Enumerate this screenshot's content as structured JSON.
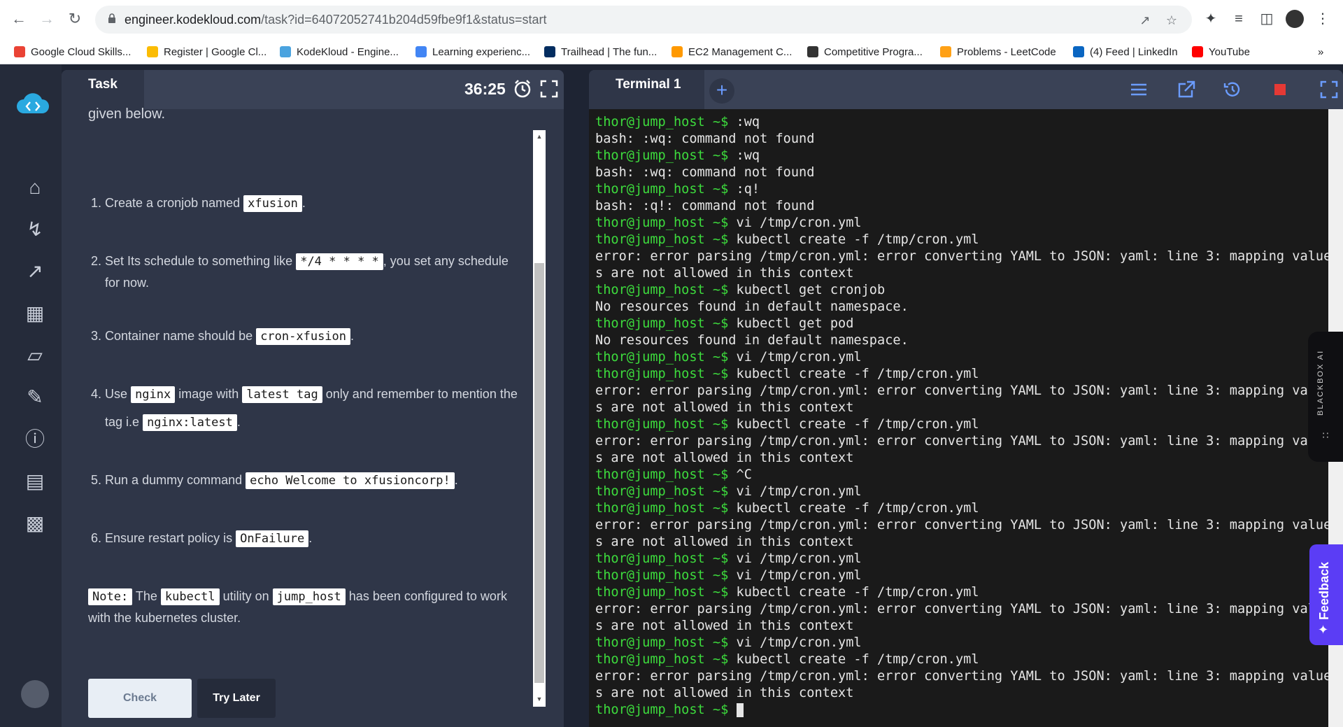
{
  "browser": {
    "url_host": "engineer.kodekloud.com",
    "url_rest": "/task?id=64072052741b204d59fbe9f1&status=start",
    "bookmarks": [
      {
        "label": "Google Cloud Skills...",
        "color": "#ea4335"
      },
      {
        "label": "Register | Google Cl...",
        "color": "#fbbc04"
      },
      {
        "label": "KodeKloud - Engine...",
        "color": "#4aa3df"
      },
      {
        "label": "Learning experienc...",
        "color": "#4285f4"
      },
      {
        "label": "Trailhead | The fun...",
        "color": "#032d60"
      },
      {
        "label": "EC2 Management C...",
        "color": "#ff9900"
      },
      {
        "label": "Competitive Progra...",
        "color": "#333333"
      },
      {
        "label": "Problems - LeetCode",
        "color": "#ffa116"
      },
      {
        "label": "(4) Feed | LinkedIn",
        "color": "#0a66c2"
      },
      {
        "label": "YouTube",
        "color": "#ff0000"
      }
    ],
    "more": "»"
  },
  "task": {
    "tab_label": "Task",
    "timer": "36:25",
    "intro_partial": "given below.",
    "steps": {
      "s1_num": "1.",
      "s1_a": "Create a cronjob named",
      "s1_code": "xfusion",
      "s1_b": ".",
      "s2_num": "2.",
      "s2_a": "Set Its schedule to something like",
      "s2_code": "*/4 * * * *",
      "s2_b": ", you set any schedule",
      "s2_c": "for now.",
      "s3_num": "3.",
      "s3_a": "Container name should be",
      "s3_code": "cron-xfusion",
      "s3_b": ".",
      "s4_num": "4.",
      "s4_a": "Use",
      "s4_code1": "nginx",
      "s4_b": "image with",
      "s4_code2": "latest tag",
      "s4_c": "only and remember to mention the",
      "s4_d": "tag i.e",
      "s4_code3": "nginx:latest",
      "s4_e": ".",
      "s5_num": "5.",
      "s5_a": "Run a dummy command",
      "s5_code": "echo Welcome to xfusioncorp!",
      "s5_b": ".",
      "s6_num": "6.",
      "s6_a": "Ensure restart policy is",
      "s6_code": "OnFailure",
      "s6_b": "."
    },
    "note": {
      "label": "Note:",
      "a": "The",
      "code1": "kubectl",
      "b": "utility on",
      "code2": "jump_host",
      "c": "has been configured to work",
      "d": "with the kubernetes cluster."
    },
    "check_label": "Check",
    "later_label": "Try Later"
  },
  "terminal": {
    "tab_label": "Terminal 1",
    "prompt": "thor@jump_host ~$",
    "lines": [
      {
        "p": true,
        "t": " :wq"
      },
      {
        "p": false,
        "t": "bash: :wq: command not found"
      },
      {
        "p": true,
        "t": " :wq"
      },
      {
        "p": false,
        "t": "bash: :wq: command not found"
      },
      {
        "p": true,
        "t": " :q!"
      },
      {
        "p": false,
        "t": "bash: :q!: command not found"
      },
      {
        "p": true,
        "t": " vi /tmp/cron.yml"
      },
      {
        "p": true,
        "t": " kubectl create -f /tmp/cron.yml"
      },
      {
        "p": false,
        "t": "error: error parsing /tmp/cron.yml: error converting YAML to JSON: yaml: line 3: mapping value"
      },
      {
        "p": false,
        "t": "s are not allowed in this context"
      },
      {
        "p": true,
        "t": " kubectl get cronjob"
      },
      {
        "p": false,
        "t": "No resources found in default namespace."
      },
      {
        "p": true,
        "t": " kubectl get pod"
      },
      {
        "p": false,
        "t": "No resources found in default namespace."
      },
      {
        "p": true,
        "t": " vi /tmp/cron.yml"
      },
      {
        "p": true,
        "t": " kubectl create -f /tmp/cron.yml"
      },
      {
        "p": false,
        "t": "error: error parsing /tmp/cron.yml: error converting YAML to JSON: yaml: line 3: mapping valu"
      },
      {
        "p": false,
        "t": "s are not allowed in this context"
      },
      {
        "p": true,
        "t": " kubectl create -f /tmp/cron.yml"
      },
      {
        "p": false,
        "t": "error: error parsing /tmp/cron.yml: error converting YAML to JSON: yaml: line 3: mapping valu"
      },
      {
        "p": false,
        "t": "s are not allowed in this context"
      },
      {
        "p": true,
        "t": " ^C"
      },
      {
        "p": true,
        "t": " vi /tmp/cron.yml"
      },
      {
        "p": true,
        "t": " kubectl create -f /tmp/cron.yml"
      },
      {
        "p": false,
        "t": "error: error parsing /tmp/cron.yml: error converting YAML to JSON: yaml: line 3: mapping value"
      },
      {
        "p": false,
        "t": "s are not allowed in this context"
      },
      {
        "p": true,
        "t": " vi /tmp/cron.yml"
      },
      {
        "p": true,
        "t": " vi /tmp/cron.yml"
      },
      {
        "p": true,
        "t": " kubectl create -f /tmp/cron.yml"
      },
      {
        "p": false,
        "t": "error: error parsing /tmp/cron.yml: error converting YAML to JSON: yaml: line 3: mapping valu"
      },
      {
        "p": false,
        "t": "s are not allowed in this context"
      },
      {
        "p": true,
        "t": " vi /tmp/cron.yml"
      },
      {
        "p": true,
        "t": " kubectl create -f /tmp/cron.yml"
      },
      {
        "p": false,
        "t": "error: error parsing /tmp/cron.yml: error converting YAML to JSON: yaml: line 3: mapping value"
      },
      {
        "p": false,
        "t": "s are not allowed in this context"
      },
      {
        "p": true,
        "t": " ",
        "cursor": true
      }
    ]
  },
  "widgets": {
    "blackbox_label": "BLACKBOX AI",
    "feedback_label": "Feedback"
  },
  "colors": {
    "prompt": "#3ddc3d",
    "accent": "#6b9cff",
    "stop": "#e53935",
    "feedback": "#5b3df5"
  }
}
